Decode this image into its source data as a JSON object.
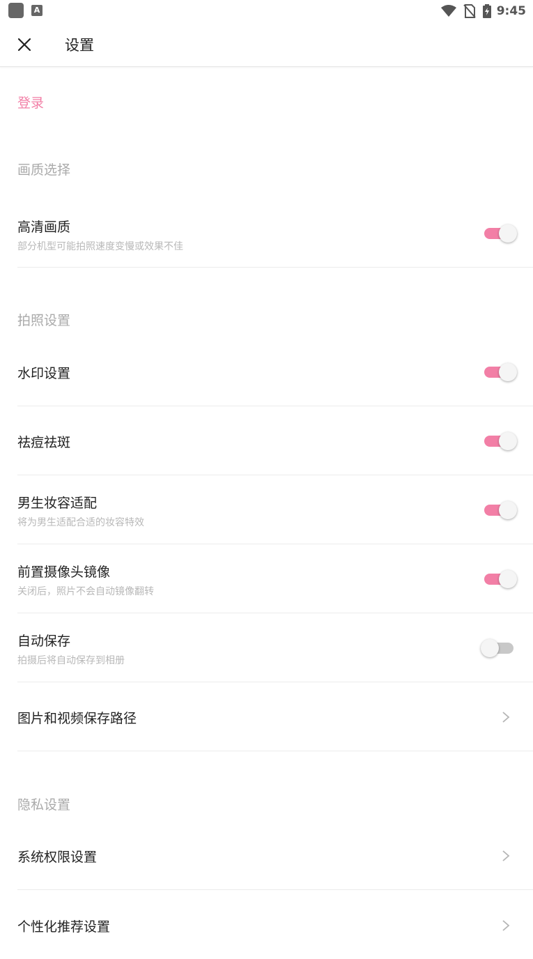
{
  "status_bar": {
    "time": "9:45",
    "a_label": "A"
  },
  "app_bar": {
    "title": "设置"
  },
  "login": {
    "label": "登录"
  },
  "sections": {
    "quality": {
      "header": "画质选择",
      "hd": {
        "title": "高清画质",
        "subtitle": "部分机型可能拍照速度变慢或效果不佳",
        "enabled": true
      }
    },
    "photo": {
      "header": "拍照设置",
      "watermark": {
        "title": "水印设置",
        "enabled": true
      },
      "acne": {
        "title": "祛痘祛斑",
        "enabled": true
      },
      "male_makeup": {
        "title": "男生妆容适配",
        "subtitle": "将为男生适配合适的妆容特效",
        "enabled": true
      },
      "front_mirror": {
        "title": "前置摄像头镜像",
        "subtitle": "关闭后，照片不会自动镜像翻转",
        "enabled": true
      },
      "auto_save": {
        "title": "自动保存",
        "subtitle": "拍摄后将自动保存到相册",
        "enabled": false
      },
      "save_path": {
        "title": "图片和视频保存路径"
      }
    },
    "privacy": {
      "header": "隐私设置",
      "permissions": {
        "title": "系统权限设置"
      },
      "personalized": {
        "title": "个性化推荐设置"
      }
    }
  },
  "colors": {
    "accent": "#f27fa6",
    "toggle_off": "#c8c8c8",
    "section_header": "#aaaaaa"
  }
}
